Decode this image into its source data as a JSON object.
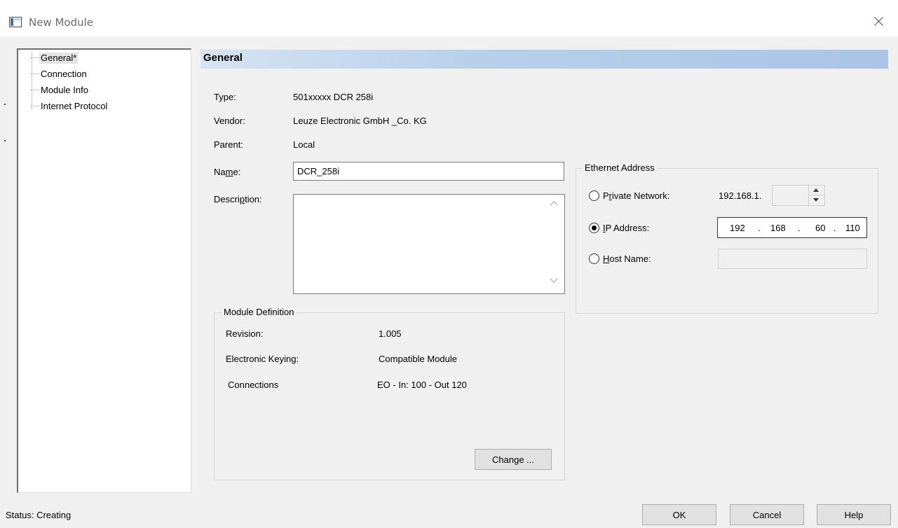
{
  "window": {
    "title": "New Module",
    "icons": {
      "app": "module-window-icon",
      "close": "close-icon"
    }
  },
  "tree": {
    "items": [
      {
        "label": "General*",
        "selected": true
      },
      {
        "label": "Connection",
        "selected": false
      },
      {
        "label": "Module Info",
        "selected": false
      },
      {
        "label": "Internet Protocol",
        "selected": false
      }
    ]
  },
  "general": {
    "section_title": "General",
    "type_label": "Type:",
    "type_value": "501xxxxx DCR 258i",
    "vendor_label": "Vendor:",
    "vendor_value": "Leuze Electronic GmbH _Co. KG",
    "parent_label": "Parent:",
    "parent_value": "Local",
    "name_label_pre": "Na",
    "name_label_ul": "m",
    "name_label_post": "e:",
    "name_value": "DCR_258i",
    "description_label_pre": "Descri",
    "description_label_ul": "p",
    "description_label_post": "tion:",
    "description_value": ""
  },
  "module_definition": {
    "title": "Module Definition",
    "revision_label": "Revision:",
    "revision_value": "1.005",
    "keying_label": "Electronic Keying:",
    "keying_value": "Compatible Module",
    "connections_label": "Connections",
    "connections_value": "EO - In: 100 - Out 120",
    "change_label_pre": "Chan",
    "change_label_ul": "g",
    "change_label_post": "e ..."
  },
  "ethernet": {
    "title": "Ethernet Address",
    "private_label_pre": "P",
    "private_label_ul": "r",
    "private_label_post": "ivate Network:",
    "private_prefix": "192.168.1.",
    "private_selected": false,
    "ip_label_ul": "I",
    "ip_label_post": "P Address:",
    "ip_selected": true,
    "ip_octets": [
      "192",
      "168",
      "60",
      "110"
    ],
    "ip_dot": ".",
    "host_label_ul": "H",
    "host_label_post": "ost Name:",
    "host_selected": false,
    "host_value": ""
  },
  "footer": {
    "status": "Status: Creating",
    "ok": "OK",
    "cancel": "Cancel",
    "help": "Help"
  }
}
